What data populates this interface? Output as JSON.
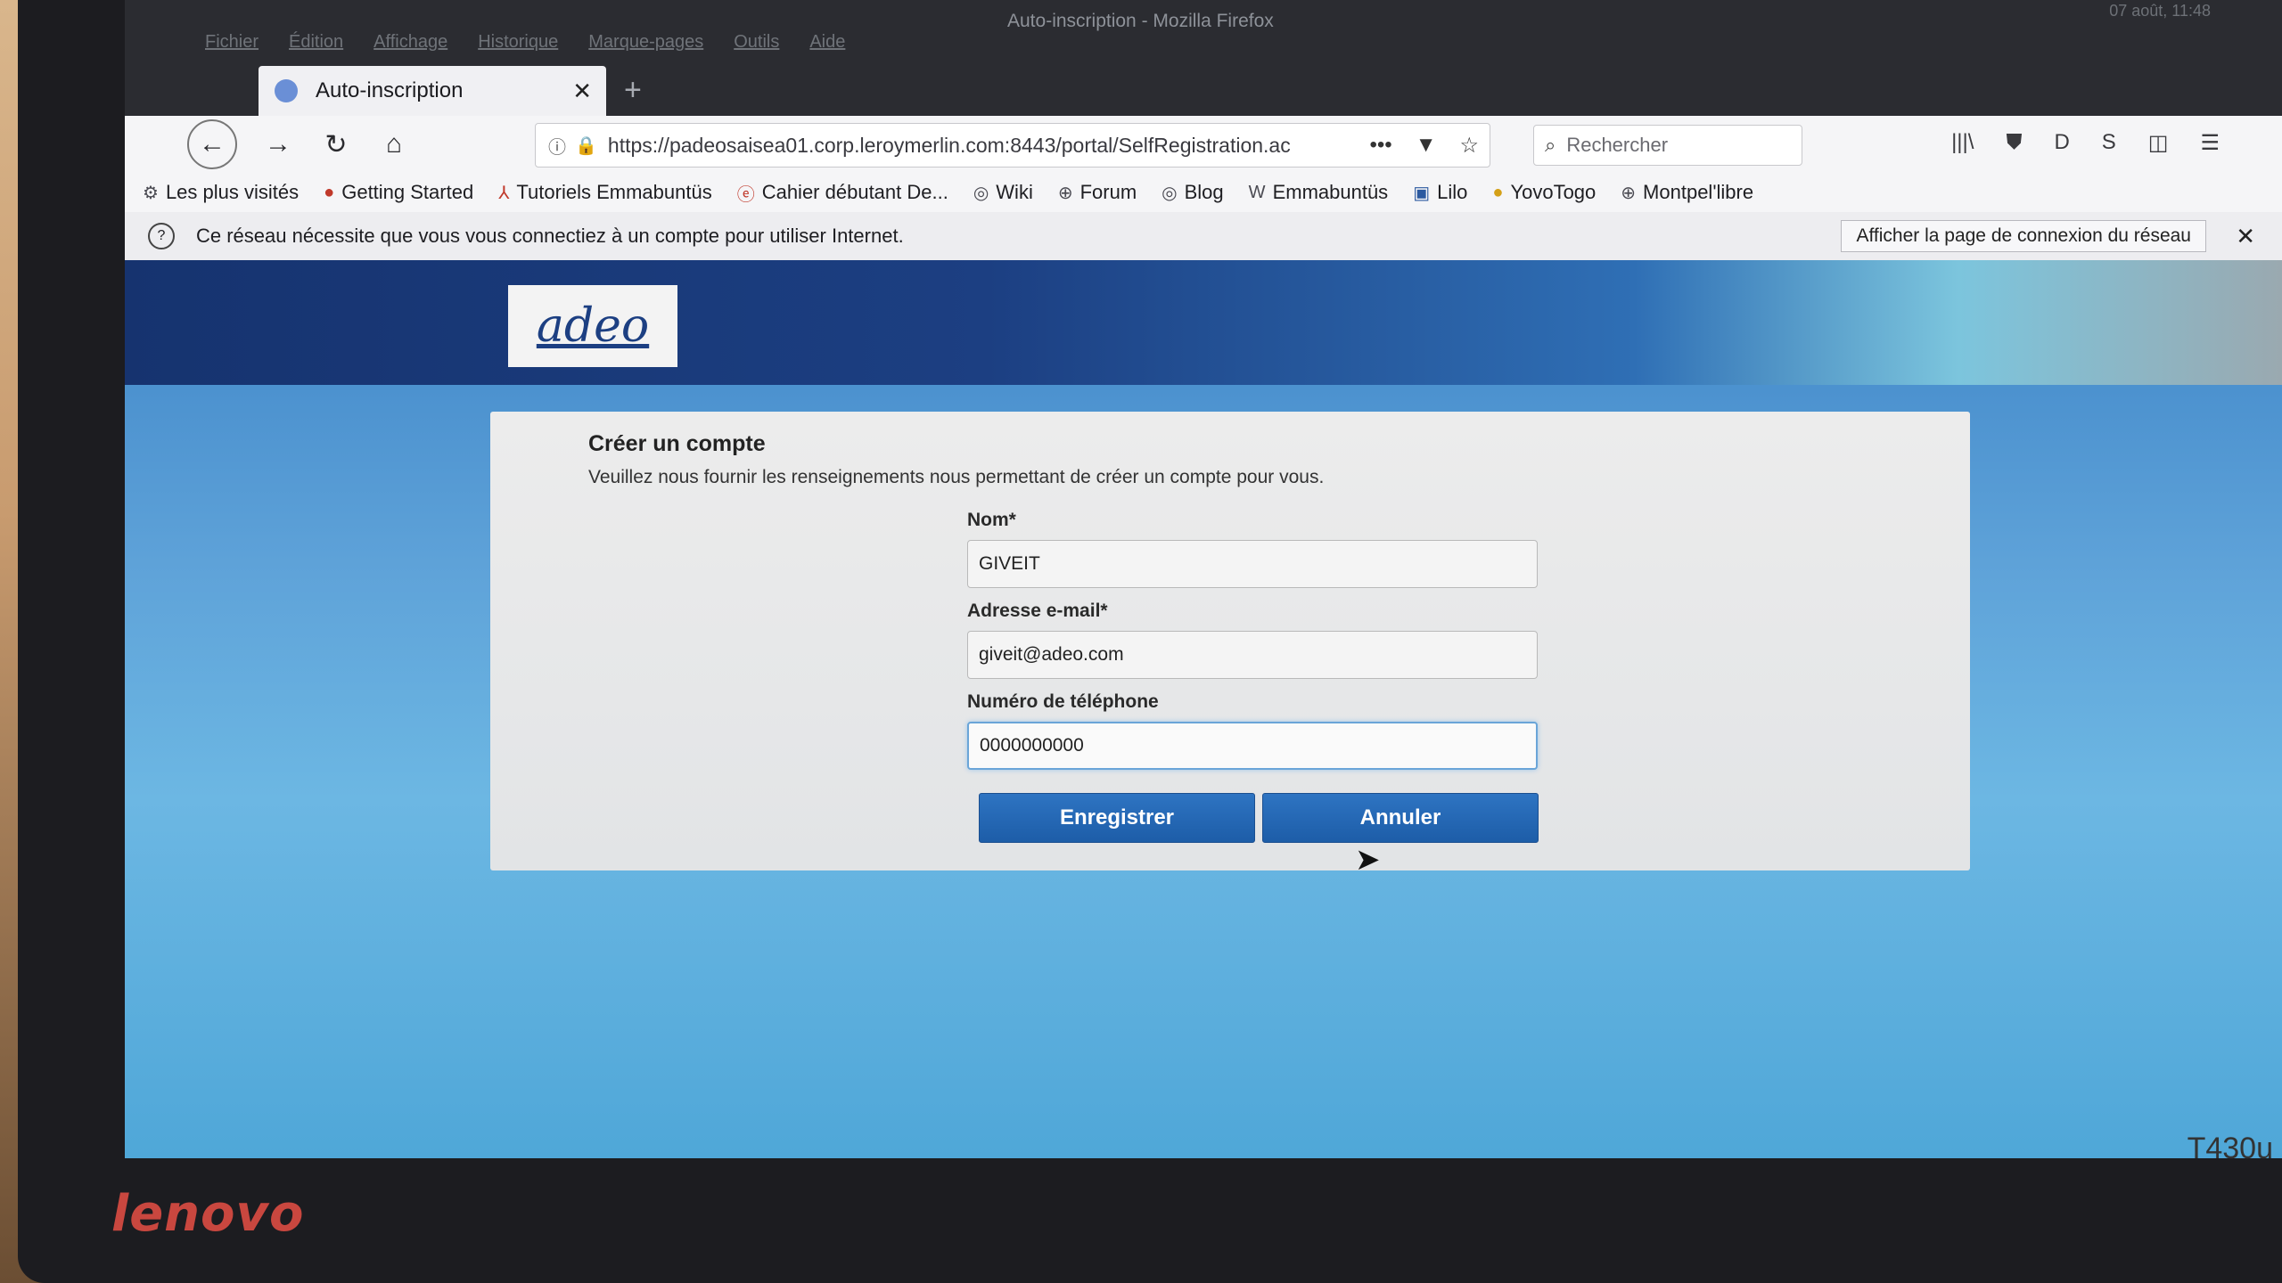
{
  "window": {
    "title": "Auto-inscription - Mozilla Firefox",
    "menu": [
      "Fichier",
      "Édition",
      "Affichage",
      "Historique",
      "Marque-pages",
      "Outils",
      "Aide"
    ],
    "clock": "07 août, 11:48"
  },
  "tab": {
    "label": "Auto-inscription"
  },
  "toolbar": {
    "url": "https://padeosaisea01.corp.leroymerlin.com:8443/portal/SelfRegistration.ac",
    "search_placeholder": "Rechercher"
  },
  "bookmarks": [
    {
      "label": "Les plus visités",
      "icon": "gear-icon"
    },
    {
      "label": "Getting Started",
      "icon": "firefox-icon"
    },
    {
      "label": "Tutoriels Emmabuntüs",
      "icon": "tutorial-icon"
    },
    {
      "label": "Cahier débutant De...",
      "icon": "debian-icon"
    },
    {
      "label": "Wiki",
      "icon": "wiki-icon"
    },
    {
      "label": "Forum",
      "icon": "globe-icon"
    },
    {
      "label": "Blog",
      "icon": "blog-icon"
    },
    {
      "label": "Emmabuntüs",
      "icon": "w-icon"
    },
    {
      "label": "Lilo",
      "icon": "lilo-icon"
    },
    {
      "label": "YovoTogo",
      "icon": "yovotogo-icon"
    },
    {
      "label": "Montpel'libre",
      "icon": "globe-icon"
    }
  ],
  "notification": {
    "message": "Ce réseau nécessite que vous vous connectiez à un compte pour utiliser Internet.",
    "button_label": "Afficher la page de connexion du réseau"
  },
  "page": {
    "logo_text": "adeo",
    "form": {
      "title": "Créer un compte",
      "subtitle": "Veuillez nous fournir les renseignements nous permettant de créer un compte pour vous.",
      "name_label": "Nom*",
      "name_value": "GIVEIT",
      "email_label": "Adresse e-mail*",
      "email_value": "giveit@adeo.com",
      "phone_label": "Numéro de téléphone",
      "phone_value": "0000000000",
      "submit_label": "Enregistrer",
      "cancel_label": "Annuler"
    }
  },
  "device": {
    "brand": "lenovo",
    "model": "T430u"
  },
  "colors": {
    "primary_button": "#1d5da8",
    "banner": "#1c3f82",
    "page_bg": "#5fa3d9"
  }
}
